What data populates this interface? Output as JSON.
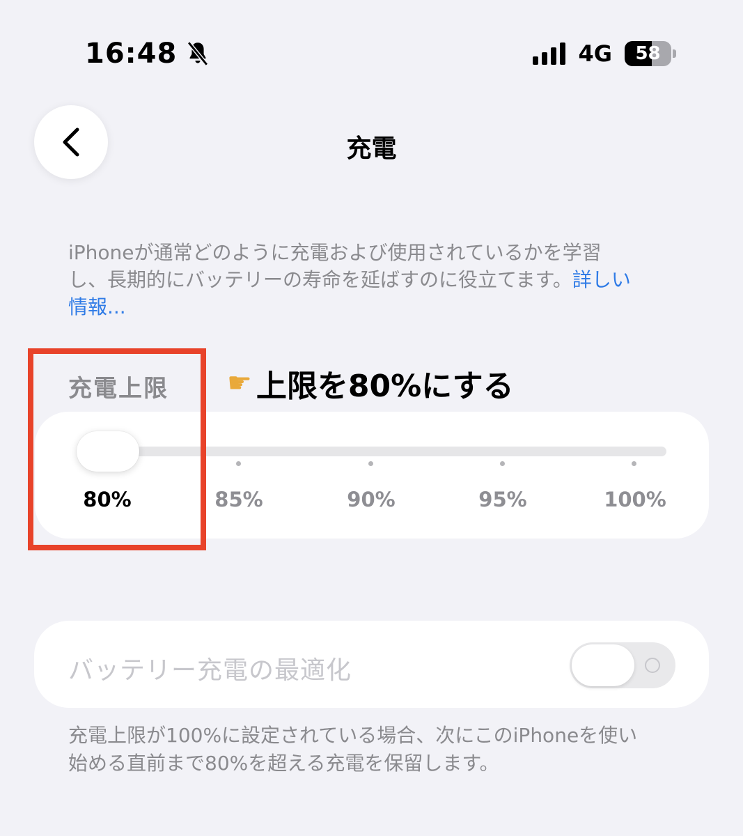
{
  "status_bar": {
    "time": "16:48",
    "network": "4G",
    "battery_level": "58"
  },
  "nav": {
    "title": "充電"
  },
  "description": {
    "text": "iPhoneが通常どのように充電および使用されているかを学習し、長期的にバッテリーの寿命を延ばすのに役立てます。",
    "link_text": "詳しい情報..."
  },
  "charge_limit": {
    "section_label": "充電上限",
    "annotation": "上限を80%にする",
    "selected_value": 80,
    "options": [
      "80%",
      "85%",
      "90%",
      "95%",
      "100%"
    ]
  },
  "optimization": {
    "label": "バッテリー充電の最適化",
    "enabled": false
  },
  "footnote": "充電上限が100%に設定されている場合、次にこのiPhoneを使い始める直前まで80%を超える充電を保留します。",
  "colors": {
    "background": "#f2f2f7",
    "link": "#2f7be6",
    "highlight": "#e8432a"
  }
}
